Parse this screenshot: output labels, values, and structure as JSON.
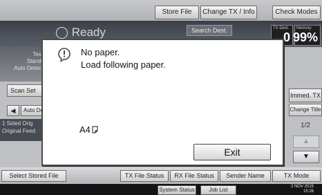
{
  "top_bar": {
    "store_file": "Store File",
    "change_tx_info": "Change TX / Info",
    "check_modes": "Check Modes"
  },
  "header": {
    "status": "Ready",
    "search_dest": "Search Dest.",
    "tx_dest_label": "TX Dest.",
    "tx_dest_value": "0",
    "memory_label": "Memory",
    "memory_value": "99%"
  },
  "left_panel": {
    "lines": [
      "Text",
      "Stand.",
      "Auto Detect"
    ],
    "scan_settings": "Scan Set",
    "left_arrow": "◀",
    "auto_detect_btn": "Auto De",
    "sided_orig": "1 Sided Orig",
    "original_feed": "Original Feed"
  },
  "right_panel": {
    "immed_tx": "Immed. TX",
    "change_title": "Change Title",
    "page": "1/2",
    "up_arrow": "▲",
    "down_arrow": "▼"
  },
  "dialog": {
    "line1": "No paper.",
    "line2": "Load following paper.",
    "paper_size": "A4",
    "exit_label": "Exit"
  },
  "bottom_tabs": {
    "select_stored_file": "Select Stored File",
    "tx_file_status": "TX File Status",
    "rx_file_status": "RX File Status",
    "sender_name": "Sender Name",
    "tx_mode": "TX Mode"
  },
  "status_bar": {
    "system_status": "System Status",
    "job_list": "Job List",
    "date": "2 NOV  2015",
    "time": "15:26"
  }
}
